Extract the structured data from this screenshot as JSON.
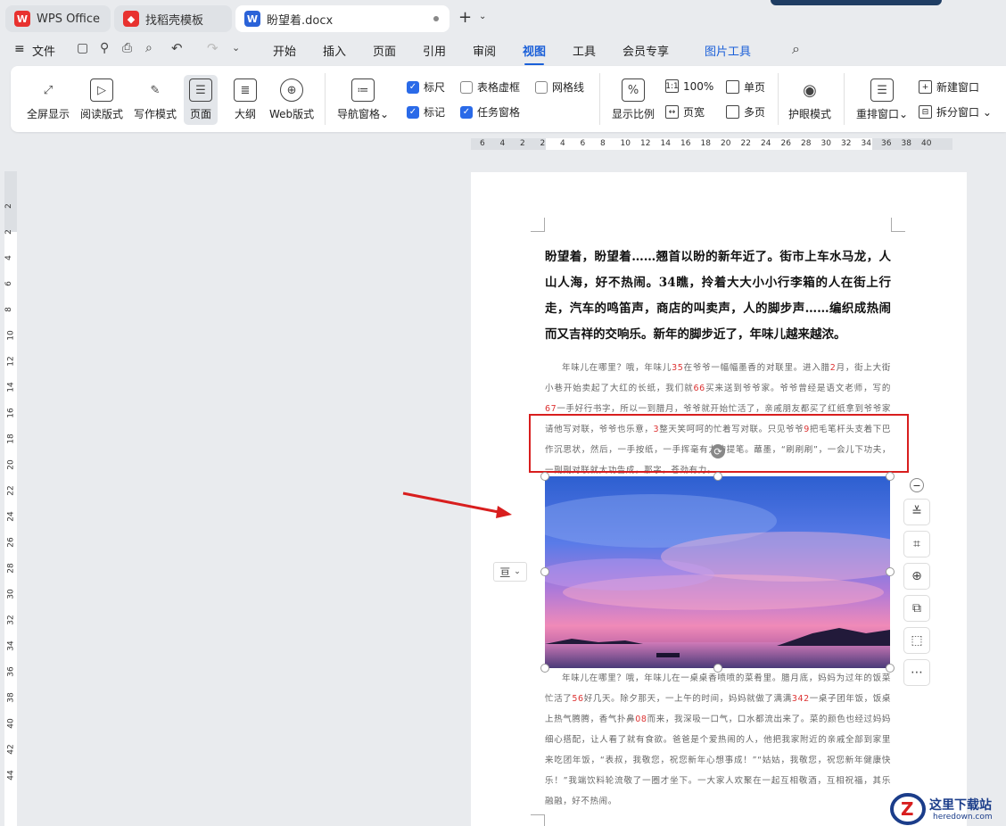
{
  "tabs": {
    "wps": "WPS Office",
    "template": "找稻壳模板",
    "doc": "盼望着.docx"
  },
  "menu": {
    "file": "文件",
    "items": [
      "开始",
      "插入",
      "页面",
      "引用",
      "审阅",
      "视图",
      "工具",
      "会员专享"
    ],
    "active": "视图",
    "picture_tools": "图片工具"
  },
  "ribbon": {
    "views": [
      "全屏显示",
      "阅读版式",
      "写作模式",
      "页面",
      "大纲",
      "Web版式"
    ],
    "nav": "导航窗格",
    "checks": {
      "ruler": "标尺",
      "table_grid": "表格虚框",
      "gridlines": "网格线",
      "marks": "标记",
      "task_pane": "任务窗格"
    },
    "zoom": {
      "ratio": "显示比例",
      "pct": "100%",
      "pagewidth": "页宽",
      "single": "单页",
      "multi": "多页"
    },
    "eye": "护眼模式",
    "rearrange": "重排窗口",
    "newwin": "新建窗口",
    "split": "拆分窗口"
  },
  "hruler": [
    "6",
    "4",
    "2",
    "2",
    "4",
    "6",
    "8",
    "10",
    "12",
    "14",
    "16",
    "18",
    "20",
    "22",
    "24",
    "26",
    "28",
    "30",
    "32",
    "34",
    "36",
    "38",
    "40"
  ],
  "vruler": [
    "2",
    "2",
    "4",
    "6",
    "8",
    "10",
    "12",
    "14",
    "16",
    "18",
    "20",
    "22",
    "24",
    "26",
    "28",
    "30",
    "32",
    "34",
    "36",
    "38",
    "40",
    "42",
    "44"
  ],
  "doc": {
    "para1": "盼望着，盼望着……翘首以盼的新年近了。街市上车水马龙，人山人海，好不热闹。34瞧，拎着大大小小行李箱的人在街上行走，汽车的鸣笛声，商店的叫卖声，人的脚步声……编织成热闹而又吉祥的交响乐。新年的脚步近了，年味儿越来越浓。",
    "para2": "年味儿在哪里？哦，年味儿35在爷爷一幅幅墨香的对联里。进入腊2月，街上大街小巷开始卖起了大红的长纸，我们就66买来送到爷爷家。爷爷曾经是语文老师，写的67一手好行书字，所以一到腊月，爷爷就开始忙活了，亲戚朋友都买了红纸拿到爷爷家请他写对联，爷爷也乐意，3整天笑呵呵的忙着写对联。只见爷爷9把毛笔杆头支着下巴作沉思状，然后，一手按纸，一手挥毫有力的提笔。蘸墨，“刷刷刷”，一会儿下功夫，一副副对联就大功告成，那字，苍劲有力。",
    "para3": "年味儿在哪里？哦，年味儿在一桌桌香喷喷的菜肴里。腊月底，妈妈为过年的饭菜忙活了56好几天。除夕那天，一上午的时间，妈妈就做了满满342一桌子团年饭，饭桌上热气腾腾，香气扑鼻08而来，我深吸一口气，口水都流出来了。菜的颜色也经过妈妈细心搭配，让人看了就有食欲。爸爸是个爱热闹的人，他把我家附近的亲戚全部到家里来吃团年饭，“表叔，我敬您，祝您新年心想事成！”“姑姑，我敬您，祝您新年健康快乐！”我端饮料轮流敬了一圈才坐下。一大家人欢聚在一起互相敬酒，互相祝福，其乐融融，好不热闹。"
  },
  "logo": {
    "name": "这里下载站",
    "url": "heredown.com"
  }
}
